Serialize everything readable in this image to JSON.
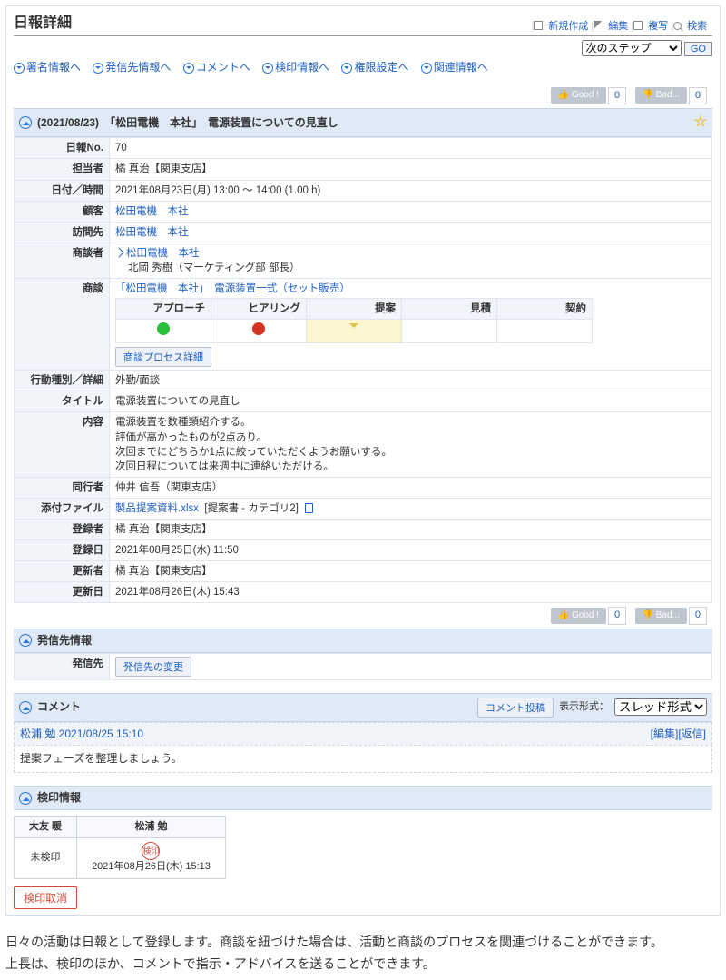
{
  "page_title": "日報詳細",
  "top_actions": {
    "new": "新規作成",
    "edit": "編集",
    "copy": "複写",
    "search": "検索"
  },
  "step": {
    "label": "次のステップ",
    "go": "GO"
  },
  "local_nav": [
    "署名情報へ",
    "発信先情報へ",
    "コメントへ",
    "検印情報へ",
    "権限設定へ",
    "関連情報へ"
  ],
  "rate": {
    "good": "Good !",
    "good_ct": "0",
    "bad": "Bad...",
    "bad_ct": "0"
  },
  "head": {
    "date": "(2021/08/23)",
    "title": "「松田電機　本社」　電源装置についての見直し"
  },
  "rows": {
    "no_l": "日報No.",
    "no_v": "70",
    "owner_l": "担当者",
    "owner_v": "橘 真治【関東支店】",
    "dt_l": "日付／時間",
    "dt_v": "2021年08月23日(月) 13:00 ～ 14:00 (1.00 h)",
    "cust_l": "顧客",
    "cust_v": "松田電機　本社",
    "visit_l": "訪問先",
    "visit_v": "松田電機　本社",
    "person_l": "商談者",
    "person_v1": "松田電機　本社",
    "person_v2": "北岡 秀樹（マーケティング部 部長）",
    "deal_l": "商談",
    "deal_v": "「松田電機　本社」　電源装置一式（セット販売）",
    "proc_btn": "商談プロセス詳細",
    "kind_l": "行動種別／詳細",
    "kind_v": "外勤/面談",
    "title_l": "タイトル",
    "title_v": "電源装置についての見直し",
    "body_l": "内容",
    "body_v": "電源装置を数種類紹介する。\n評価が高かったものが2点あり。\n次回までにどちらか1点に絞っていただくようお願いする。\n次回日程については来週中に連絡いただける。",
    "acc_l": "同行者",
    "acc_v": "仲井 信吾（関東支店）",
    "att_l": "添付ファイル",
    "att_name": "製品提案資料.xlsx",
    "att_cat": "[提案書 - カテゴリ2]",
    "reg_l": "登録者",
    "reg_v": "橘 真治【関東支店】",
    "regd_l": "登録日",
    "regd_v": "2021年08月25日(水) 11:50",
    "upd_l": "更新者",
    "upd_v": "橘 真治【関東支店】",
    "updd_l": "更新日",
    "updd_v": "2021年08月26日(木) 15:43"
  },
  "proc": {
    "cols": [
      "アプローチ",
      "ヒアリング",
      "提案",
      "見積",
      "契約"
    ]
  },
  "dist": {
    "hd": "発信先情報",
    "row_l": "発信先",
    "btn": "発信先の変更"
  },
  "comment": {
    "hd": "コメント",
    "post": "コメント投稿",
    "fmt_l": "表示形式：",
    "fmt_v": "スレッド形式",
    "author": "松浦 勉 2021/08/25 15:10",
    "acts": "[編集][返信]",
    "body": "提案フェーズを整理しましょう。"
  },
  "stamp": {
    "hd": "検印情報",
    "h1": "大友 暖",
    "h2": "松浦 勉",
    "c1": "未検印",
    "c2_mark": "検印",
    "c2_dt": "2021年08月26日(木) 15:13",
    "cancel": "検印取消"
  },
  "footnote": "日々の活動は日報として登録します。商談を紐づけた場合は、活動と商談のプロセスを関連づけることができます。\n上長は、検印のほか、コメントで指示・アドバイスを送ることができます。"
}
